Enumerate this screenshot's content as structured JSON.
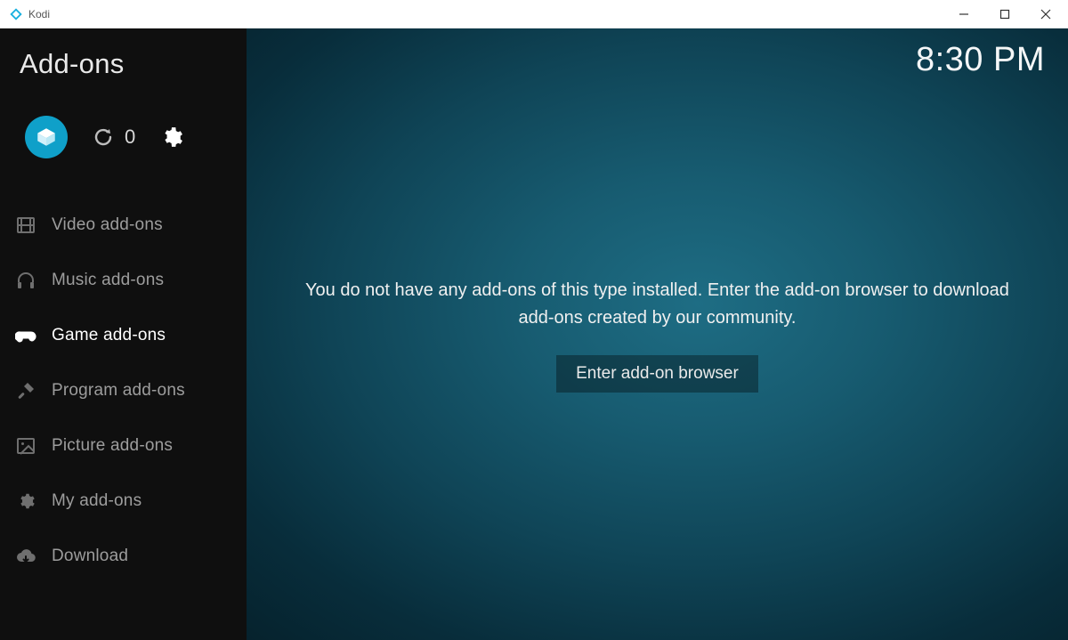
{
  "window": {
    "title": "Kodi"
  },
  "header": {
    "title": "Add-ons",
    "clock": "8:30 PM"
  },
  "topIcons": {
    "refresh_count": "0"
  },
  "sidebar": {
    "items": [
      {
        "label": "Video add-ons",
        "icon": "film-icon",
        "active": false
      },
      {
        "label": "Music add-ons",
        "icon": "headphones-icon",
        "active": false
      },
      {
        "label": "Game add-ons",
        "icon": "gamepad-icon",
        "active": true
      },
      {
        "label": "Program add-ons",
        "icon": "tools-icon",
        "active": false
      },
      {
        "label": "Picture add-ons",
        "icon": "image-icon",
        "active": false
      },
      {
        "label": "My add-ons",
        "icon": "puzzle-gear-icon",
        "active": false
      },
      {
        "label": "Download",
        "icon": "cloud-down-icon",
        "active": false
      }
    ]
  },
  "main": {
    "empty_message": "You do not have any add-ons of this type installed. Enter the add-on browser to download add-ons created by our community.",
    "enter_button": "Enter add-on browser"
  }
}
